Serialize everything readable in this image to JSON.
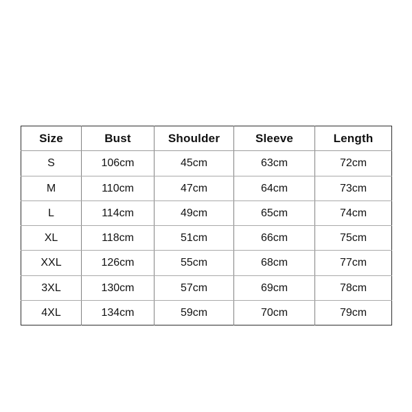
{
  "chart_data": {
    "type": "table",
    "title": "",
    "columns": [
      "Size",
      "Bust",
      "Shoulder",
      "Sleeve",
      "Length"
    ],
    "rows": [
      [
        "S",
        "106cm",
        "45cm",
        "63cm",
        "72cm"
      ],
      [
        "M",
        "110cm",
        "47cm",
        "64cm",
        "73cm"
      ],
      [
        "L",
        "114cm",
        "49cm",
        "65cm",
        "74cm"
      ],
      [
        "XL",
        "118cm",
        "51cm",
        "66cm",
        "75cm"
      ],
      [
        "XXL",
        "126cm",
        "55cm",
        "68cm",
        "77cm"
      ],
      [
        "3XL",
        "130cm",
        "57cm",
        "69cm",
        "78cm"
      ],
      [
        "4XL",
        "134cm",
        "59cm",
        "70cm",
        "79cm"
      ]
    ],
    "units": "cm",
    "measurements": {
      "sizes": [
        "S",
        "M",
        "L",
        "XL",
        "XXL",
        "3XL",
        "4XL"
      ],
      "bust_cm": [
        106,
        110,
        114,
        118,
        126,
        130,
        134
      ],
      "shoulder_cm": [
        45,
        47,
        49,
        51,
        55,
        57,
        59
      ],
      "sleeve_cm": [
        63,
        64,
        65,
        66,
        68,
        69,
        70
      ],
      "length_cm": [
        72,
        73,
        74,
        75,
        77,
        78,
        79
      ]
    },
    "colors": {
      "background": "#ffffff",
      "text": "#111111",
      "outer_border": "#2b2b2b",
      "inner_gridline": "#a8a8a8",
      "column_divider": "#808080"
    }
  }
}
